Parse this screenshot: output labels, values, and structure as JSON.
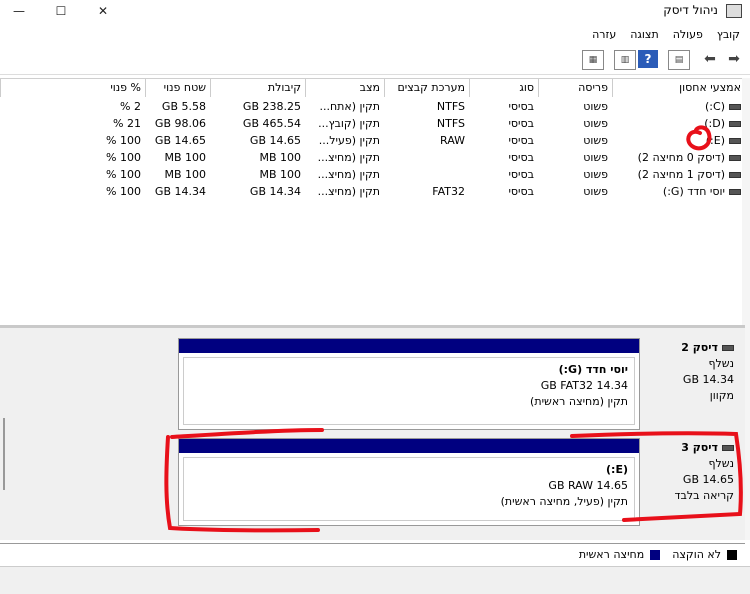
{
  "window": {
    "title": "ניהול דיסק",
    "minimize_glyph": "—",
    "maximize_glyph": "☐",
    "close_glyph": "✕"
  },
  "menu": [
    "קובץ",
    "פעולה",
    "תצוגה",
    "עזרה"
  ],
  "table": {
    "columns": [
      "אמצעי אחסון",
      "פריסה",
      "סוג",
      "מערכת קבצים",
      "מצב",
      "קיבולת",
      "שטח פנוי",
      "% פנוי"
    ],
    "rows": [
      {
        "volume": "(C:)",
        "layout": "פשוט",
        "type": "בסיסי",
        "fs": "NTFS",
        "status": "תקין (אתח...",
        "capacity": "238.25 GB",
        "free": "5.58 GB",
        "pct": "2 %"
      },
      {
        "volume": "(D:)",
        "layout": "פשוט",
        "type": "בסיסי",
        "fs": "NTFS",
        "status": "תקין (קובץ...",
        "capacity": "465.54 GB",
        "free": "98.06 GB",
        "pct": "21 %"
      },
      {
        "volume": "(E:)",
        "layout": "פשוט",
        "type": "בסיסי",
        "fs": "RAW",
        "status": "תקין (פעיל...",
        "capacity": "14.65 GB",
        "free": "14.65 GB",
        "pct": "100 %"
      },
      {
        "volume": "(דיסק 0 מחיצה 2)",
        "layout": "פשוט",
        "type": "בסיסי",
        "fs": "",
        "status": "תקין (מחיצ...",
        "capacity": "100 MB",
        "free": "100 MB",
        "pct": "100 %"
      },
      {
        "volume": "(דיסק 1 מחיצה 2)",
        "layout": "פשוט",
        "type": "בסיסי",
        "fs": "",
        "status": "תקין (מחיצ...",
        "capacity": "100 MB",
        "free": "100 MB",
        "pct": "100 %"
      },
      {
        "volume": "יוסי חדד (G:)",
        "layout": "פשוט",
        "type": "בסיסי",
        "fs": "FAT32",
        "status": "תקין (מחיצ...",
        "capacity": "14.34 GB",
        "free": "14.34 GB",
        "pct": "100 %"
      }
    ]
  },
  "disks": [
    {
      "name": "דיסק 2",
      "kind": "נשלף",
      "size": "14.34 GB",
      "state": "מקוון",
      "partition": {
        "title": "יוסי חדד (G:)",
        "detail": "14.34 GB FAT32",
        "status": "תקין (מחיצה ראשית)"
      }
    },
    {
      "name": "דיסק 3",
      "kind": "נשלף",
      "size": "14.65 GB",
      "state": "קריאה בלבד",
      "partition": {
        "title": "(E:)",
        "detail": "14.65 GB RAW",
        "status": "תקין (פעיל, מחיצה ראשית)"
      }
    }
  ],
  "legend": [
    {
      "label": "לא הוקצה",
      "color": "#000000"
    },
    {
      "label": "מחיצה ראשית",
      "color": "#000080"
    }
  ],
  "annotation_color": "#e8101a"
}
